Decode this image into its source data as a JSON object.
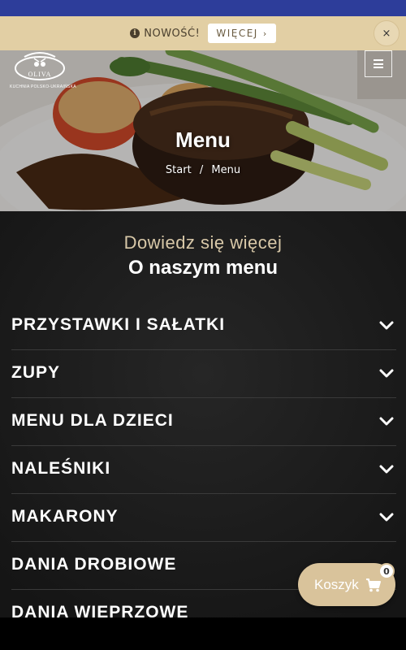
{
  "notice": {
    "label": "NOWOŚĆ!",
    "button_label": "WIĘCEJ",
    "close_label": "×"
  },
  "logo": {
    "name": "OLIVA",
    "tagline": "KUCHNIA POLSKO-UKRAIŃSKA"
  },
  "hero": {
    "title": "Menu",
    "breadcrumb": {
      "home": "Start",
      "separator": "/",
      "current": "Menu"
    }
  },
  "section": {
    "subtitle": "Dowiedz się więcej",
    "title": "O naszym menu"
  },
  "categories": [
    {
      "label": "PRZYSTAWKI I SAŁATKI"
    },
    {
      "label": "ZUPY"
    },
    {
      "label": "MENU DLA DZIECI"
    },
    {
      "label": "NALEŚNIKI"
    },
    {
      "label": "MAKARONY"
    },
    {
      "label": "DANIA DROBIOWE"
    },
    {
      "label": "DANIA WIEPRZOWE"
    }
  ],
  "cart": {
    "label": "Koszyk",
    "count": "0"
  },
  "colors": {
    "status_bar": "#2d3d9a",
    "notice_bg": "#e2cfa4",
    "accent_gold": "#d9c39b",
    "main_bg": "#1b1b1b"
  },
  "icons": [
    "info-icon",
    "chevron-right-icon",
    "close-icon",
    "hamburger-icon",
    "chevron-down-icon",
    "cart-icon"
  ]
}
